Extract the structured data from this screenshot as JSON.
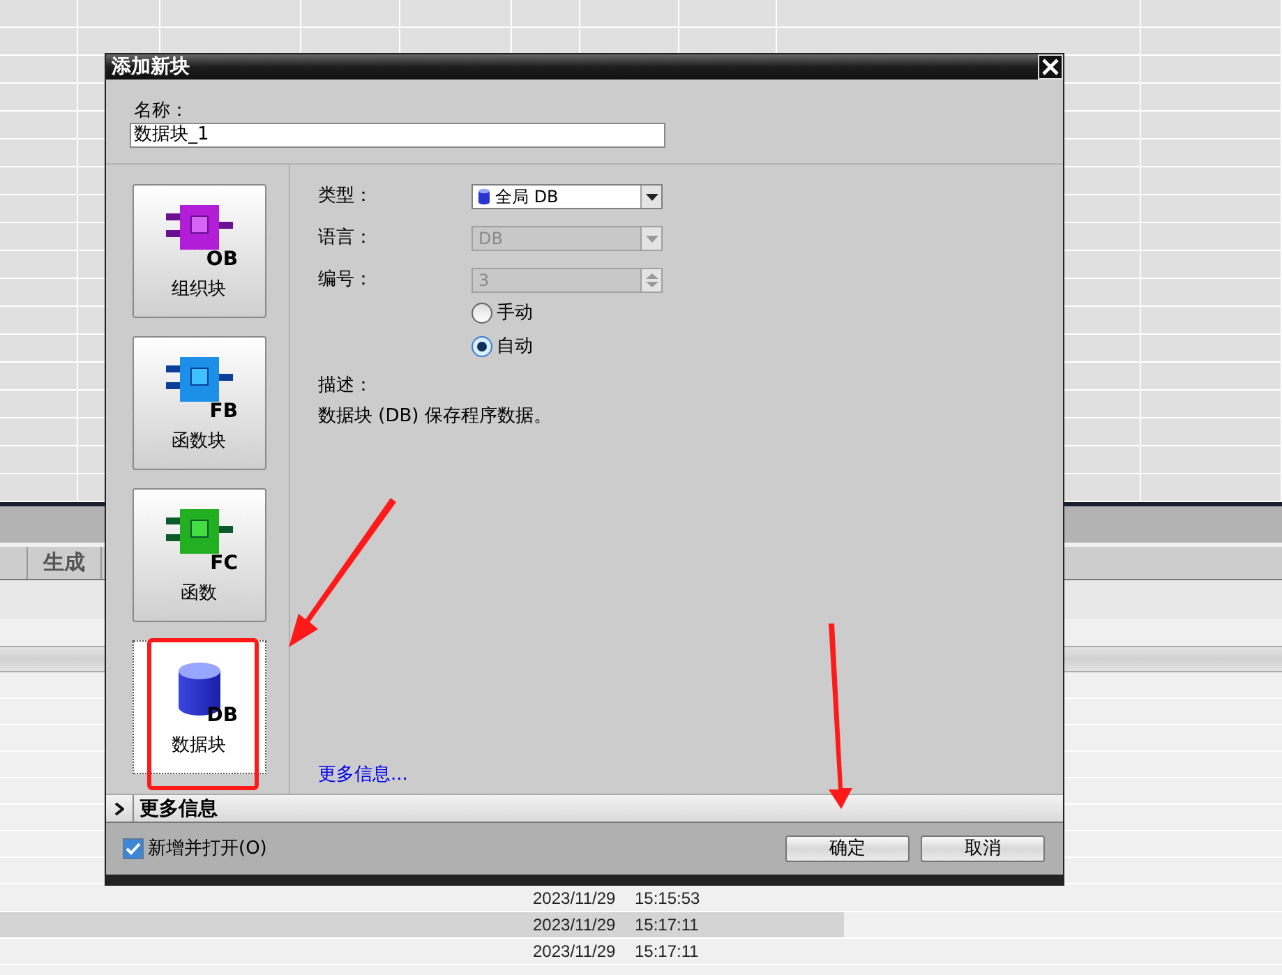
{
  "dialog": {
    "title": "添加新块",
    "name_label": "名称：",
    "name_value": "数据块_1",
    "blocks": [
      {
        "kind": "ob",
        "code": "OB",
        "label": "组织块",
        "selected": false
      },
      {
        "kind": "fb",
        "code": "FB",
        "label": "函数块",
        "selected": false
      },
      {
        "kind": "fc",
        "code": "FC",
        "label": "函数",
        "selected": false
      },
      {
        "kind": "db",
        "code": "DB",
        "label": "数据块",
        "selected": true
      }
    ],
    "fields": [
      {
        "kind": "dropdown",
        "label": "类型：",
        "value": "全局 DB",
        "disabled": false
      },
      {
        "kind": "dropdown",
        "label": "语言：",
        "value": "DB",
        "disabled": true
      },
      {
        "kind": "spinner",
        "label": "编号：",
        "value": "3",
        "disabled": true
      }
    ],
    "numbering": [
      {
        "label": "手动",
        "selected": false
      },
      {
        "label": "自动",
        "selected": true
      }
    ],
    "description_label": "描述：",
    "description": "数据块 (DB) 保存程序数据。",
    "more_info_link": "更多信息...",
    "more_info_section": {
      "label": "更多信息",
      "expanded": false
    },
    "open_after_add": {
      "label": "新增并打开(O)",
      "checked": true
    },
    "buttons": [
      {
        "label": "确定"
      },
      {
        "label": "取消"
      }
    ]
  },
  "background": {
    "column_header": "生成",
    "rows": [
      {
        "date": "2023/11/29",
        "time": "15:15:53",
        "selected": false
      },
      {
        "date": "2023/11/29",
        "time": "15:17:11",
        "selected": true
      },
      {
        "date": "2023/11/29",
        "time": "15:17:11",
        "selected": false
      }
    ]
  }
}
